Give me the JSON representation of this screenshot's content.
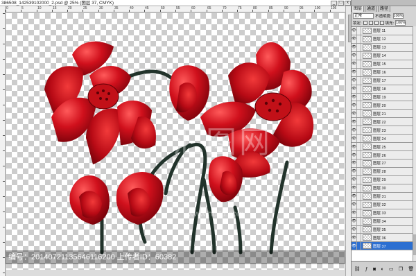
{
  "document": {
    "title": "386508_142539102000_2.psd @ 25% (图层 37, CMYK)",
    "controls": {
      "minimize": "_",
      "maximize": "□",
      "close": "x"
    },
    "ruler_marks": [
      "0",
      "5",
      "10",
      "15",
      "20",
      "25",
      "30",
      "35",
      "40",
      "45",
      "50",
      "55",
      "60",
      "65",
      "70",
      "75",
      "80",
      "85",
      "90",
      "95",
      "100",
      "105"
    ]
  },
  "watermark": {
    "text": "编号：20140721135646116200 上传者ID：60382",
    "logo": "汇图网",
    "url": "www.huitu.com"
  },
  "panel": {
    "tabs": [
      "图层",
      "通道",
      "路径"
    ],
    "blend_mode": "正常",
    "opacity_label": "不透明度:",
    "opacity_value": "100%",
    "lock_label": "锁定:",
    "fill_label": "填充:",
    "fill_value": "100%",
    "layers": [
      {
        "name": "图层 11"
      },
      {
        "name": "图层 12"
      },
      {
        "name": "图层 13"
      },
      {
        "name": "图层 14"
      },
      {
        "name": "图层 15"
      },
      {
        "name": "图层 16"
      },
      {
        "name": "图层 17"
      },
      {
        "name": "图层 18"
      },
      {
        "name": "图层 19"
      },
      {
        "name": "图层 20"
      },
      {
        "name": "图层 21"
      },
      {
        "name": "图层 22"
      },
      {
        "name": "图层 23"
      },
      {
        "name": "图层 24"
      },
      {
        "name": "图层 25"
      },
      {
        "name": "图层 26"
      },
      {
        "name": "图层 27"
      },
      {
        "name": "图层 28"
      },
      {
        "name": "图层 29"
      },
      {
        "name": "图层 30"
      },
      {
        "name": "图层 31"
      },
      {
        "name": "图层 32"
      },
      {
        "name": "图层 33"
      },
      {
        "name": "图层 34"
      },
      {
        "name": "图层 35"
      },
      {
        "name": "图层 36"
      },
      {
        "name": "图层 37"
      }
    ],
    "selected_layer": "图层 37",
    "footer_icons": [
      "link-icon",
      "fx-icon",
      "mask-icon",
      "adjustment-icon",
      "folder-icon",
      "new-layer-icon",
      "trash-icon"
    ]
  },
  "colors": {
    "flower_red": "#d0101c",
    "flower_dark": "#7a0008",
    "stem": "#22332b",
    "selection": "#2c6fd1"
  }
}
